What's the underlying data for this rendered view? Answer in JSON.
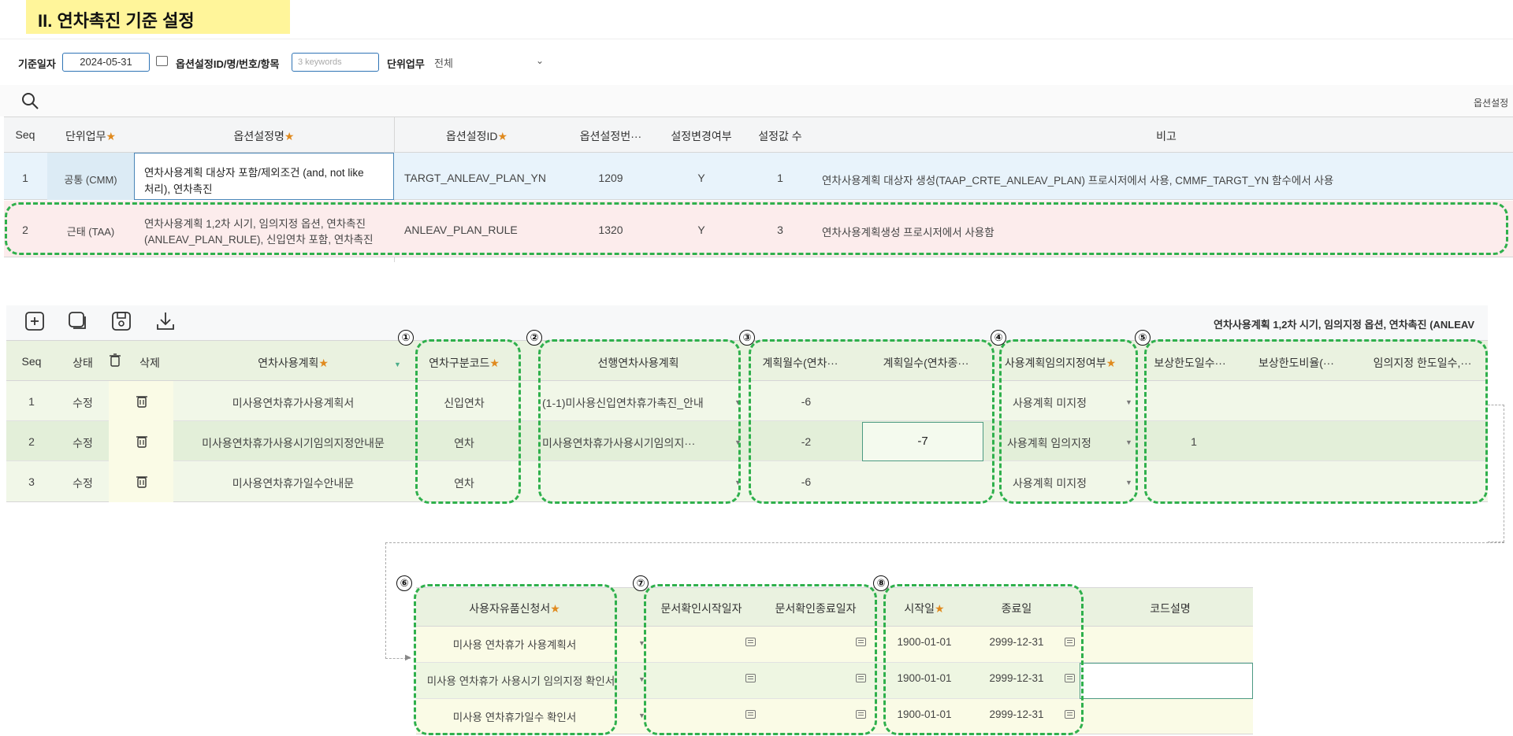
{
  "page": {
    "title": "II. 연차촉진 기준 설정"
  },
  "filter": {
    "date_label": "기준일자",
    "date_value": "2024-05-31",
    "option_label": "옵션설정ID/명/번호/항목",
    "keyword_placeholder": "3 keywords",
    "unit_label": "단위업무",
    "unit_value": "전체"
  },
  "top_grid": {
    "right_label": "옵션설정",
    "headers": {
      "seq": "Seq",
      "unit": "단위업무",
      "name": "옵션설정명",
      "id": "옵션설정ID",
      "no": "옵션설정번···",
      "changed": "설정변경여부",
      "count": "설정값 수",
      "note": "비고"
    },
    "rows": [
      {
        "seq": "1",
        "unit": "공통 (CMM)",
        "name_line1": "연차사용계획 대상자 포함/제외조건 (and, not like",
        "name_line2": "처리), 연차촉진",
        "id": "TARGT_ANLEAV_PLAN_YN",
        "no": "1209",
        "changed": "Y",
        "count": "1",
        "note": "연차사용계획 대상자 생성(TAAP_CRTE_ANLEAV_PLAN) 프로시저에서 사용, CMMF_TARGT_YN 함수에서 사용"
      },
      {
        "seq": "2",
        "unit": "근태 (TAA)",
        "name_line1": "연차사용계획 1,2차 시기, 임의지정 옵션, 연차촉진",
        "name_line2": "(ANLEAV_PLAN_RULE), 신입연차 포함, 연차촉진",
        "id": "ANLEAV_PLAN_RULE",
        "no": "1320",
        "changed": "Y",
        "count": "3",
        "note": "연차사용계획생성 프로시저에서 사용함"
      }
    ]
  },
  "mid_grid": {
    "right_label": "연차사용계획 1,2차 시기, 임의지정 옵션, 연차촉진 (ANLEAV",
    "headers": {
      "seq": "Seq",
      "status": "상태",
      "delete": "삭제",
      "plan": "연차사용계획",
      "code": "연차구분코드",
      "prev": "선행연차사용계획",
      "months": "계획월수(연차···",
      "days": "계획일수(연차종···",
      "designate": "사용계획임의지정여부",
      "comp_days": "보상한도일수···",
      "comp_ratio": "보상한도비율(···",
      "limit_days": "임의지정 한도일수,···"
    },
    "rows": [
      {
        "seq": "1",
        "status": "수정",
        "plan": "미사용연차휴가사용계획서",
        "code": "신입연차",
        "prev": "(1-1)미사용신입연차휴가촉진_안내",
        "months": "-6",
        "days": "",
        "designate": "사용계획 미지정",
        "comp_days": ""
      },
      {
        "seq": "2",
        "status": "수정",
        "plan": "미사용연차휴가사용시기임의지정안내문",
        "code": "연차",
        "prev": "미사용연차휴가사용시기임의지···",
        "months": "-2",
        "days": "-7",
        "designate": "사용계획 임의지정",
        "comp_days": "1"
      },
      {
        "seq": "3",
        "status": "수정",
        "plan": "미사용연차휴가일수안내문",
        "code": "연차",
        "prev": "",
        "months": "-6",
        "days": "",
        "designate": "사용계획 미지정",
        "comp_days": ""
      }
    ]
  },
  "bottom_grid": {
    "headers": {
      "form": "사용자유품신청서",
      "doc_start": "문서확인시작일자",
      "doc_end": "문서확인종료일자",
      "start": "시작일",
      "end": "종료일",
      "desc": "코드설명"
    },
    "rows": [
      {
        "form": "미사용 연차휴가 사용계획서",
        "start": "1900-01-01",
        "end": "2999-12-31"
      },
      {
        "form": "미사용 연차휴가 사용시기 임의지정 확인서",
        "start": "1900-01-01",
        "end": "2999-12-31"
      },
      {
        "form": "미사용 연차휴가일수 확인서",
        "start": "1900-01-01",
        "end": "2999-12-31"
      }
    ]
  },
  "markers": [
    "①",
    "②",
    "③",
    "④",
    "⑤",
    "⑥",
    "⑦",
    "⑧"
  ],
  "colors": {
    "title_highlight": "#fff59a",
    "dashed_border": "#2fb04c",
    "row_blue": "#e8f3fb",
    "row_pink": "#fcecec",
    "row_green": "#eef6e2",
    "row_yellow": "#fafbe6",
    "star": "#e08a1e"
  }
}
